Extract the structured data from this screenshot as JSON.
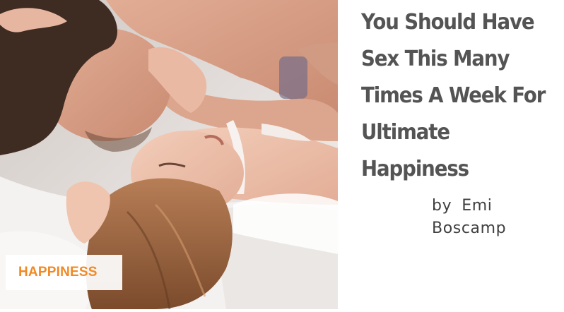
{
  "article": {
    "title": "You Should Have Sex This Many Times A Week For Ultimate Happiness",
    "category": "HAPPINESS",
    "byline": {
      "prefix": "by",
      "author": "Emi Boscamp"
    }
  },
  "colors": {
    "category_text": "#f08a24",
    "headline_text": "#545454",
    "byline_text": "#3f3f3f"
  },
  "image": {
    "icon": "photo-couple-in-bed"
  }
}
